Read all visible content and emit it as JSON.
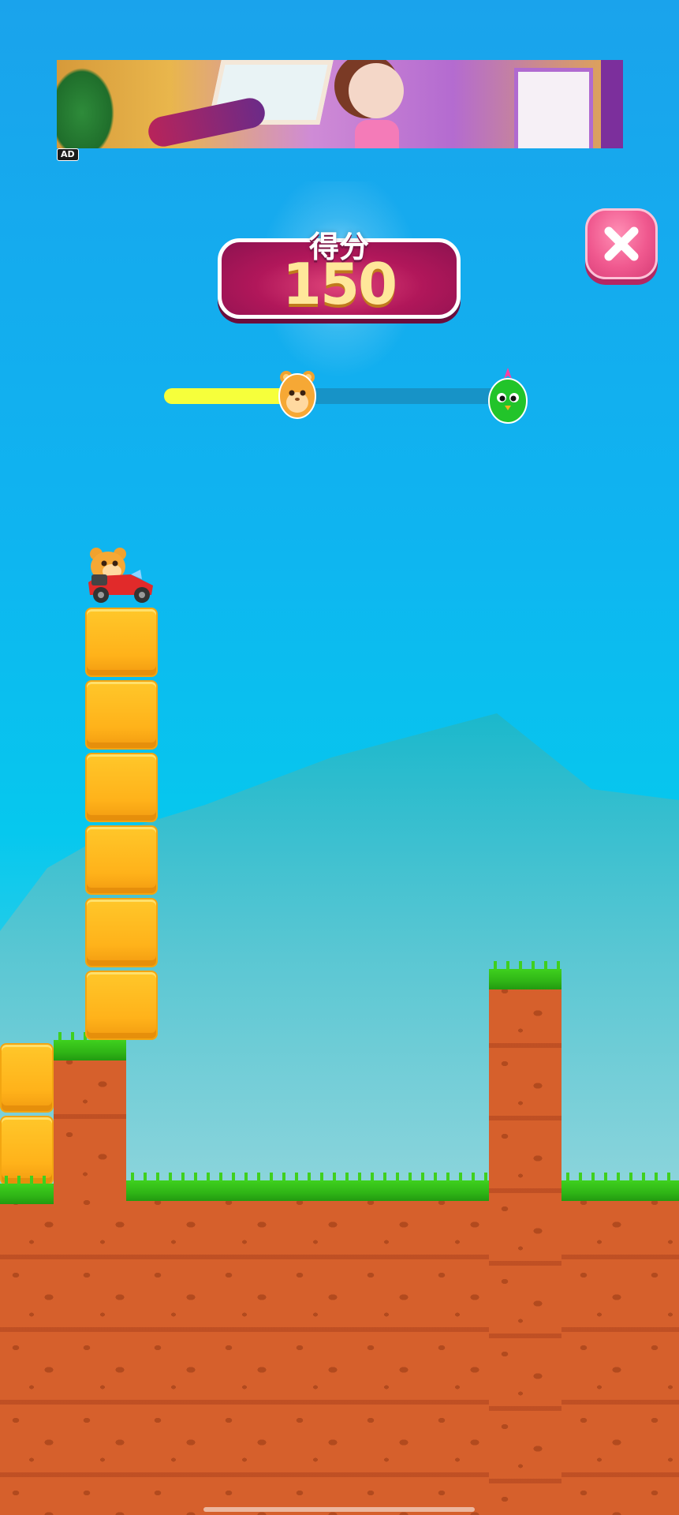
{
  "ad": {
    "badge": "AD"
  },
  "score": {
    "label": "得分",
    "value": "150"
  },
  "progress": {
    "fraction": 0.39
  },
  "buttons": {
    "close_icon": "close-icon"
  },
  "colors": {
    "sky_top": "#1aa3ec",
    "score_panel": "#b1175a",
    "score_digits": "#ffe79a",
    "progress_fill": "#f6ff3b",
    "progress_track": "#1793c7",
    "close_button": "#f0598f",
    "block": "#ffb21a",
    "dirt": "#d6602c",
    "grass": "#3fd01e"
  },
  "characters": {
    "player": "hamster-car",
    "progress_start": "hamster-icon",
    "progress_goal": "bird-icon"
  }
}
